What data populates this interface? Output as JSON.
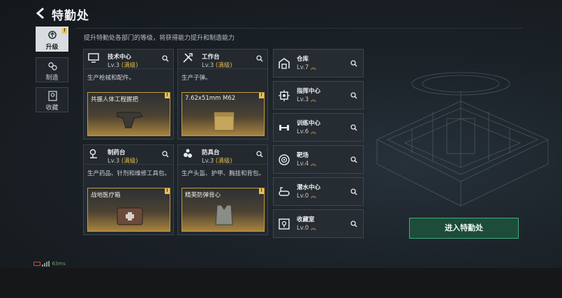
{
  "header": {
    "title": "特勤处",
    "subtitle": "提升特勤处各部门的等级，将获得能力提升和制造能力"
  },
  "nav": [
    {
      "label": "升级",
      "icon": "upgrade-icon",
      "active": true,
      "badge": "!"
    },
    {
      "label": "制造",
      "icon": "gears-icon",
      "active": false
    },
    {
      "label": "收藏",
      "icon": "collection-icon",
      "active": false
    }
  ],
  "cards": [
    {
      "name": "技术中心",
      "level": "Lv.3",
      "max": "(满级)",
      "desc": "生产枪械和配件。",
      "item": "共振人体工程握把",
      "icon": "monitor-icon",
      "badge": "!"
    },
    {
      "name": "工作台",
      "level": "Lv.3",
      "max": "(满级)",
      "desc": "生产子弹。",
      "item": "7.62x51mm M62",
      "icon": "tools-icon",
      "badge": "!"
    },
    {
      "name": "制药台",
      "level": "Lv.3",
      "max": "(满级)",
      "desc": "生产药品、针剂和维修工具包。",
      "item": "战地医疗箱",
      "icon": "microscope-icon",
      "badge": "!"
    },
    {
      "name": "防具台",
      "level": "Lv.3",
      "max": "(满级)",
      "desc": "生产头盔、护甲、胸挂和背包。",
      "item": "精英防弹背心",
      "icon": "armor-icon",
      "badge": "!"
    }
  ],
  "rooms": [
    {
      "name": "仓库",
      "level": "Lv.7",
      "icon": "warehouse-icon"
    },
    {
      "name": "指挥中心",
      "level": "Lv.3",
      "icon": "command-icon"
    },
    {
      "name": "训练中心",
      "level": "Lv.6",
      "icon": "dumbbell-icon"
    },
    {
      "name": "靶场",
      "level": "Lv.4",
      "icon": "target-icon"
    },
    {
      "name": "潜水中心",
      "level": "Lv.0",
      "icon": "diving-icon"
    },
    {
      "name": "收藏室",
      "level": "Lv.0",
      "icon": "vault-icon"
    }
  ],
  "enter_button": "进入特勤处",
  "status": {
    "ping": "63ms"
  },
  "colors": {
    "accent_gold": "#e3b84b",
    "accent_green": "#3fae7c",
    "item_border": "#c89a35"
  }
}
